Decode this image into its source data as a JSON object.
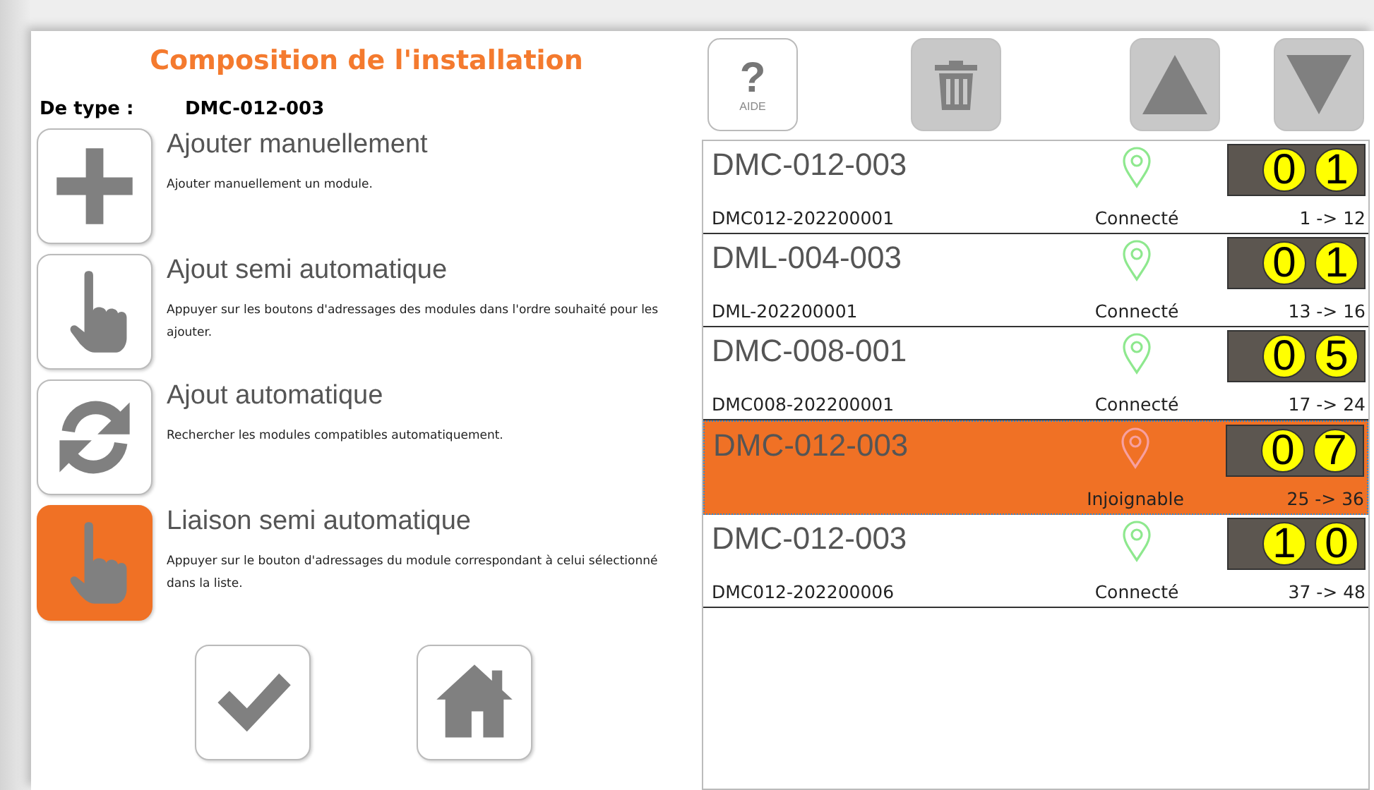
{
  "title": "Composition de l'installation",
  "type_label": "De type :",
  "type_value": "DMC-012-003",
  "modes": [
    {
      "kind": "plus",
      "title": "Ajouter manuellement",
      "description": "Ajouter manuellement un module.",
      "selected": false
    },
    {
      "kind": "hand",
      "title": "Ajout semi automatique",
      "description": "Appuyer sur les boutons d'adressages des modules dans l'ordre souhaité pour les ajouter.",
      "selected": false
    },
    {
      "kind": "refresh",
      "title": "Ajout automatique",
      "description": "Rechercher les modules compatibles automatiquement.",
      "selected": false
    },
    {
      "kind": "hand",
      "title": "Liaison semi automatique",
      "description": "Appuyer sur le bouton d'adressages du module correspondant à celui sélectionné dans la liste.",
      "selected": true
    }
  ],
  "bottom_buttons": [
    {
      "kind": "check"
    },
    {
      "kind": "home"
    }
  ],
  "toolbar": [
    {
      "kind": "help",
      "icon": "?",
      "label": "AIDE",
      "disabled": false
    },
    {
      "kind": "trash",
      "disabled": true
    },
    {
      "kind": "up",
      "disabled": true
    },
    {
      "kind": "down",
      "disabled": true
    }
  ],
  "modules": [
    {
      "name": "DMC-012-003",
      "serial": "DMC012-202200001",
      "status": "Connecté",
      "kind": "connected",
      "address": [
        "0",
        "1"
      ],
      "range": "1 -> 12",
      "selected": false
    },
    {
      "name": "DML-004-003",
      "serial": "DML-202200001",
      "status": "Connecté",
      "kind": "connected",
      "address": [
        "0",
        "1"
      ],
      "range": "13 -> 16",
      "selected": false
    },
    {
      "name": "DMC-008-001",
      "serial": "DMC008-202200001",
      "status": "Connecté",
      "kind": "connected",
      "address": [
        "0",
        "5"
      ],
      "range": "17 -> 24",
      "selected": false
    },
    {
      "name": "DMC-012-003",
      "status": "Injoignable",
      "kind": "unreachable",
      "address": [
        "0",
        "7"
      ],
      "range": "25 -> 36",
      "selected": true
    },
    {
      "name": "DMC-012-003",
      "serial": "DMC012-202200006",
      "status": "Connecté",
      "kind": "connected",
      "address": [
        "1",
        "0"
      ],
      "range": "37 -> 48",
      "selected": false
    }
  ]
}
